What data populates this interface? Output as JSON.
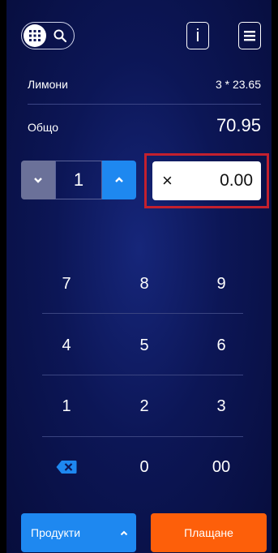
{
  "header": {
    "keypad_toggle_icon": "keypad-icon",
    "search_icon": "search-icon",
    "info_label": "i",
    "menu_icon": "hamburger-icon"
  },
  "item": {
    "name": "Лимони",
    "detail": "3 * 23.65"
  },
  "total": {
    "label": "Общо",
    "value": "70.95"
  },
  "quantity": {
    "value": "1"
  },
  "discount": {
    "symbol": "×",
    "value": "0.00"
  },
  "keypad": {
    "rows": [
      [
        "7",
        "8",
        "9"
      ],
      [
        "4",
        "5",
        "6"
      ],
      [
        "1",
        "2",
        "3"
      ],
      [
        "",
        "0",
        "00"
      ]
    ],
    "backspace_icon": "backspace-icon"
  },
  "footer": {
    "products_label": "Продукти",
    "pay_label": "Плащане"
  },
  "colors": {
    "accent_blue": "#1e88f0",
    "pay_orange": "#fd5f0a",
    "highlight_red": "#c3202e"
  }
}
